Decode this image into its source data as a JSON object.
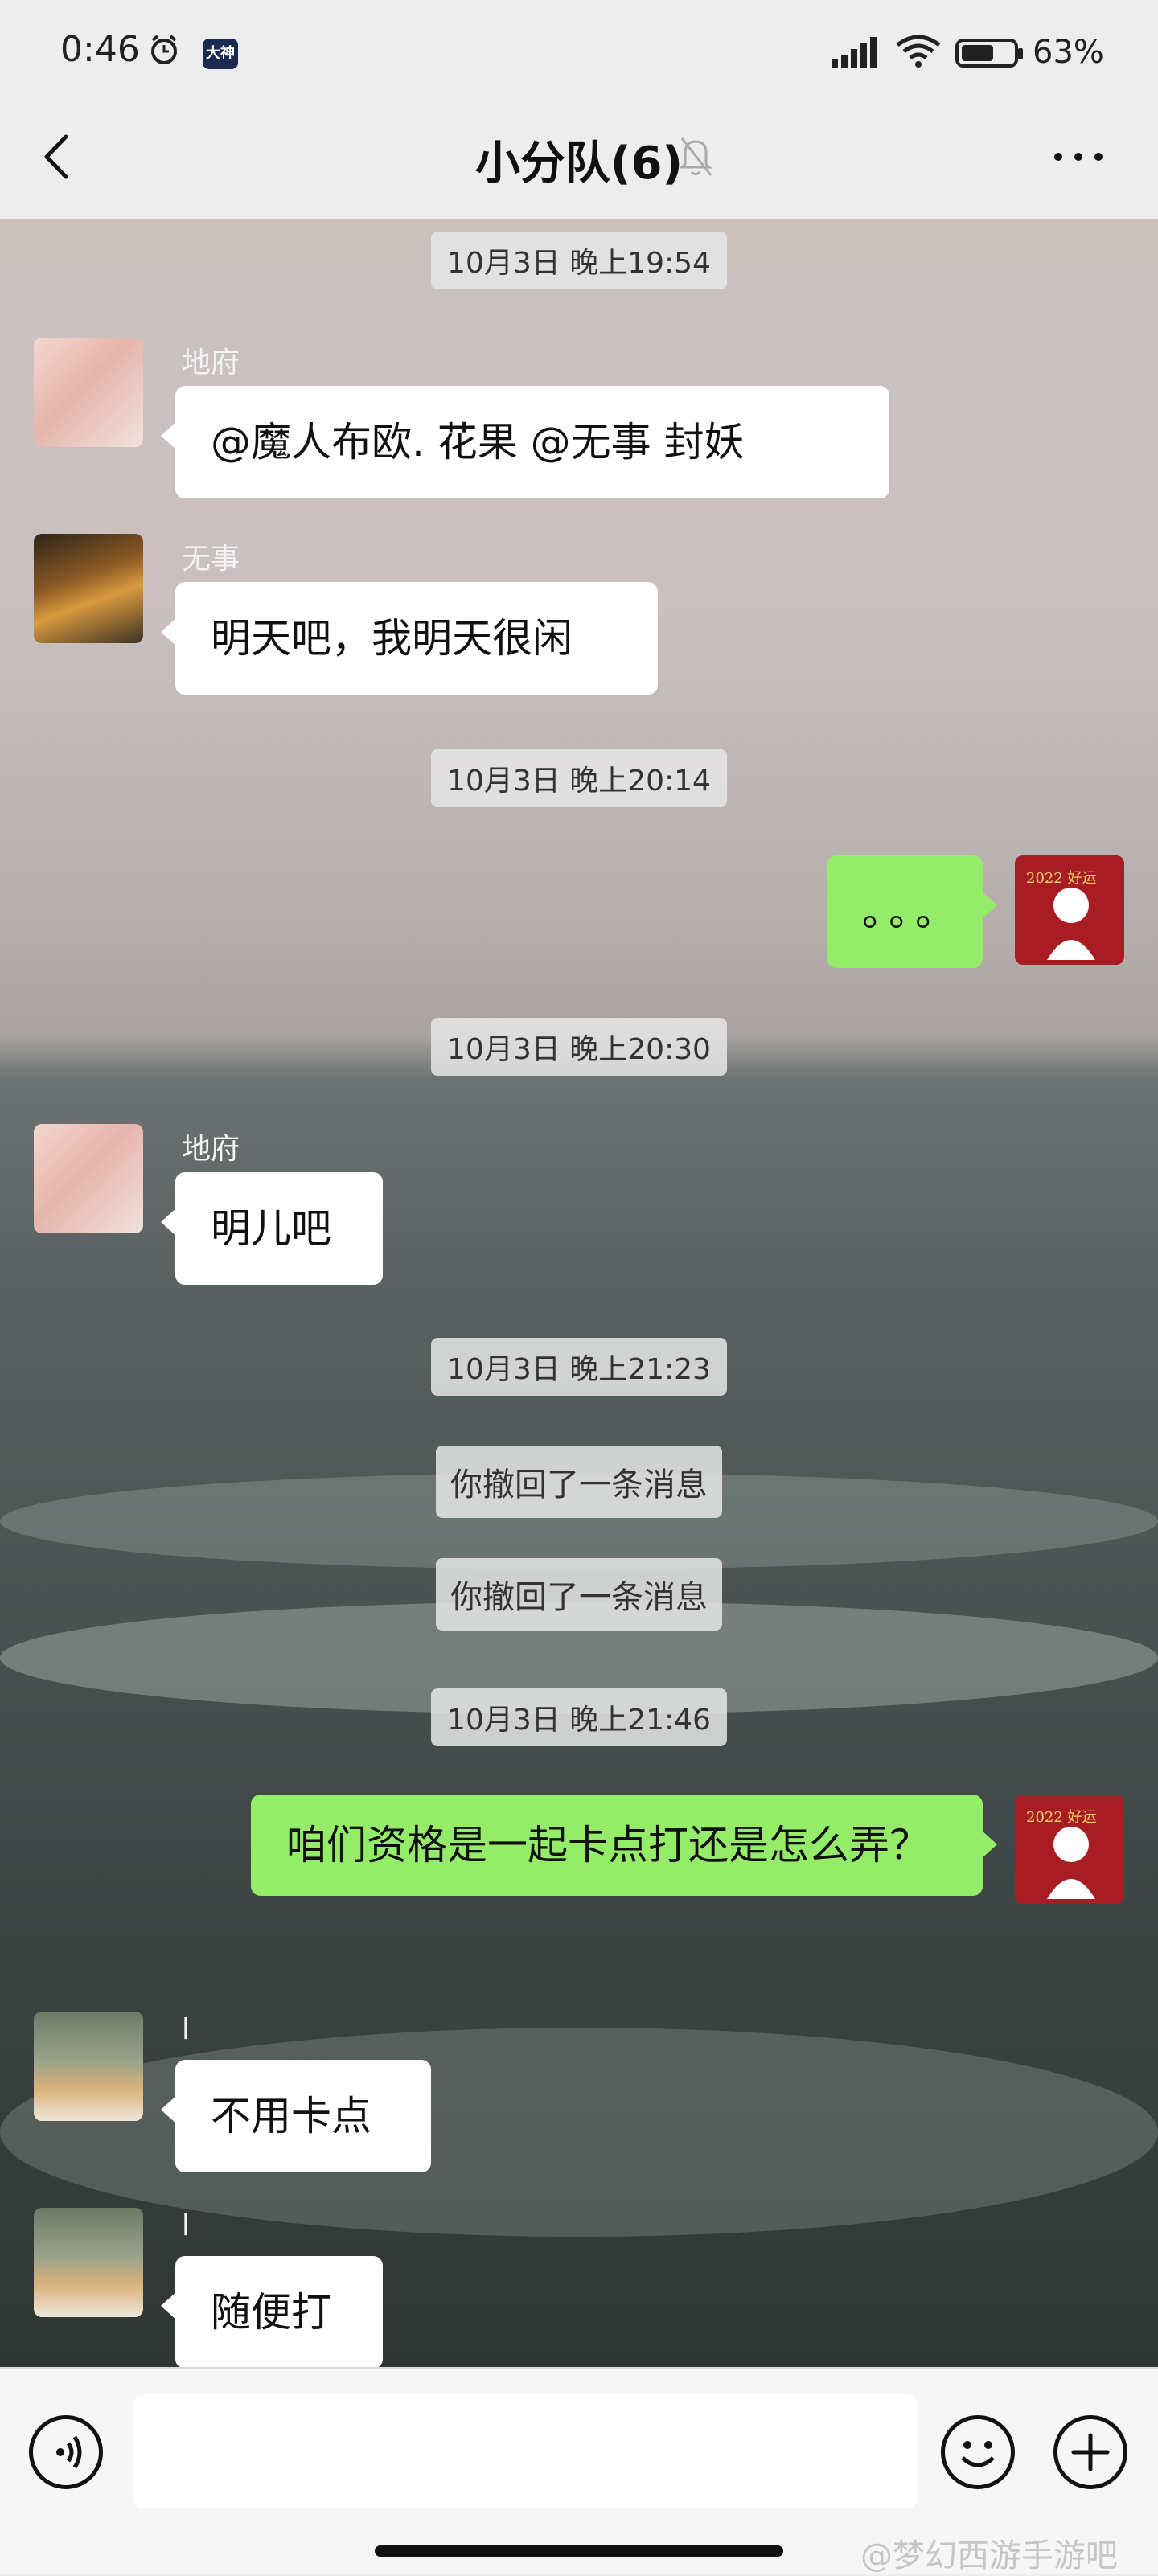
{
  "status": {
    "time": "0:46",
    "app_badge": "大神",
    "battery": "63%",
    "battery_level": 0.63
  },
  "nav": {
    "title": "小分队(6)"
  },
  "messages": {
    "ts1": "10月3日 晚上19:54",
    "m1_sender": "地府",
    "m1_text": "@魔人布欧.  花果  @无事   封妖",
    "m2_sender": "无事",
    "m2_text": "明天吧，我明天很闲",
    "ts2": "10月3日 晚上20:14",
    "m3_text": "。。。",
    "ts3": "10月3日 晚上20:30",
    "m4_sender": "地府",
    "m4_text": "明儿吧",
    "ts4": "10月3日 晚上21:23",
    "sys1": "你撤回了一条消息",
    "sys2": "你撤回了一条消息",
    "ts5": "10月3日 晚上21:46",
    "m5_text": "咱们资格是一起卡点打还是怎么弄？",
    "m6_sender": "l",
    "m6_text": "不用卡点",
    "m7_sender": "l",
    "m7_text": "随便打"
  },
  "self_avatar_text": "2022 好运",
  "watermark": "@梦幻西游手游吧",
  "colors": {
    "outgoing_bubble": "#95ec69",
    "incoming_bubble": "#ffffff",
    "self_avatar_bg": "#a81d24"
  }
}
